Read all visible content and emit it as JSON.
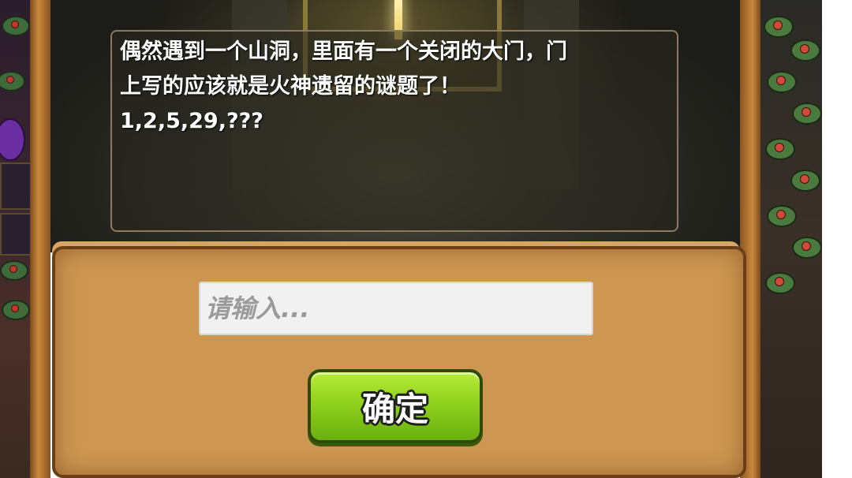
{
  "dialog": {
    "lines": [
      "偶然遇到一个山洞，里面有一个关闭的大门，门",
      "上写的应该就是火神遗留的谜题了！",
      "1,2,5,29,???"
    ]
  },
  "answer_input": {
    "value": "",
    "placeholder": "请输入..."
  },
  "confirm_button": {
    "label": "确定"
  },
  "colors": {
    "button_green": "#8fd11c",
    "panel_parchment": "#cd9752",
    "frame_wood": "#c98a3c"
  }
}
